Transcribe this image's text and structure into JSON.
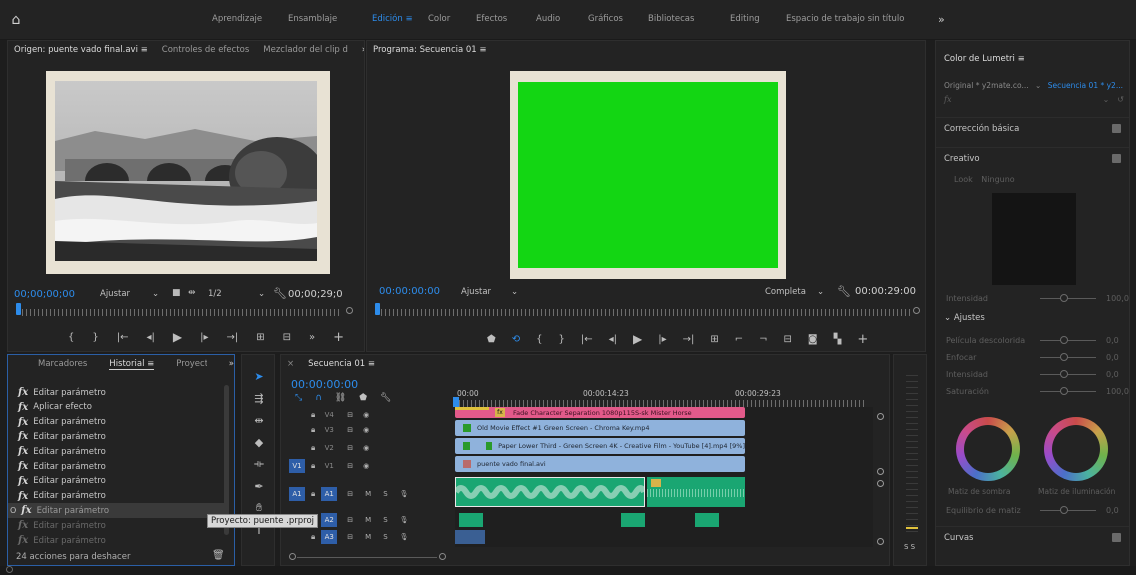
{
  "topbar": {
    "workspaces": [
      "Aprendizaje",
      "Ensamblaje",
      "Edición",
      "Color",
      "Efectos",
      "Audio",
      "Gráficos",
      "Bibliotecas",
      "Editing",
      "Espacio de trabajo sin título"
    ],
    "active": "Edición",
    "active_menu_glyph": "≡",
    "more_glyph": "»"
  },
  "source": {
    "tabs": [
      "Origen: puente vado final.avi",
      "Controles de efectos",
      "Mezclador del clip d"
    ],
    "tab_menu_glyph": "≡",
    "more_glyph": "»",
    "timecode": "00;00;00;00",
    "fit_label": "Ajustar",
    "resolution": "1/2",
    "duration": "00;00;29;0"
  },
  "program": {
    "title": "Programa: Secuencia 01",
    "title_menu_glyph": "≡",
    "timecode": "00:00:00:00",
    "fit_label": "Ajustar",
    "quality": "Completa",
    "duration": "00:00:29:00"
  },
  "project": {
    "tabs": [
      "Marcadores",
      "Historial",
      "Proyecto"
    ],
    "active": "Historial",
    "tab_menu_glyph": "≡",
    "more_glyph": "»",
    "history": [
      {
        "label": "Editar parámetro",
        "state": "normal"
      },
      {
        "label": "Aplicar efecto",
        "state": "normal"
      },
      {
        "label": "Editar parámetro",
        "state": "normal"
      },
      {
        "label": "Editar parámetro",
        "state": "normal"
      },
      {
        "label": "Editar parámetro",
        "state": "normal"
      },
      {
        "label": "Editar parámetro",
        "state": "normal"
      },
      {
        "label": "Editar parámetro",
        "state": "normal"
      },
      {
        "label": "Editar parámetro",
        "state": "normal"
      },
      {
        "label": "Editar parámetro",
        "state": "selected"
      },
      {
        "label": "Editar parámetro",
        "state": "dim"
      },
      {
        "label": "Editar parámetro",
        "state": "dim"
      }
    ],
    "status": "24 acciones para deshacer",
    "tooltip": "Proyecto: puente .prproj"
  },
  "timeline": {
    "title": "Secuencia 01",
    "title_menu_glyph": "≡",
    "timecode": "00:00:00:00",
    "ruler_labels": [
      "00:00",
      "00:00:14:23",
      "00:00:29:23"
    ],
    "tracks": [
      {
        "id": "V4",
        "src": ""
      },
      {
        "id": "V3",
        "src": ""
      },
      {
        "id": "V2",
        "src": ""
      },
      {
        "id": "V1",
        "src": "V1"
      },
      {
        "id": "A1",
        "src": "A1"
      },
      {
        "id": "A2",
        "src": ""
      },
      {
        "id": "A3",
        "src": ""
      }
    ],
    "track_flags": [
      "M",
      "S"
    ],
    "clips": [
      {
        "name": "Fade Character Separation 1080p115S-sk Mister Horse",
        "color": "#e35a8a"
      },
      {
        "name": "Old Movie Effect #1   Green Screen - Chroma Key.mp4",
        "color": "#8fb2dc"
      },
      {
        "name": "Paper Lower Third - Green Screen 4K - Creative Film - YouTube [4].mp4 [9%]",
        "color": "#8fb2dc"
      },
      {
        "name": "puente vado final.avi",
        "color": "#8fb2dc"
      }
    ],
    "meter_label": "S S"
  },
  "lumetri": {
    "title": "Color de Lumetri",
    "title_menu_glyph": "≡",
    "source_label": "Original * y2mate.co...",
    "target_label": "Secuencia 01 * y2...",
    "fx_label": "fx",
    "sections": [
      {
        "label": "Corrección básica"
      },
      {
        "label": "Creativo"
      }
    ],
    "look_label": "Look",
    "look_value": "Ninguno",
    "intensity_label": "Intensidad",
    "intensity_value": "100,0",
    "adjustments_label": "Ajustes",
    "adjustments": [
      {
        "label": "Película descolorida",
        "value": "0,0"
      },
      {
        "label": "Enfocar",
        "value": "0,0"
      },
      {
        "label": "Intensidad",
        "value": "0,0"
      },
      {
        "label": "Saturación",
        "value": "100,0"
      }
    ],
    "wheel_labels": [
      "Matiz de sombra",
      "Matiz de iluminación"
    ],
    "balance_label": "Equilibrio de matiz",
    "balance_value": "0,0",
    "curves_label": "Curvas"
  },
  "colors": {
    "accent": "#2d8ceb",
    "program_monitor": "#13d613",
    "pink_clip": "#e35a8a",
    "video_clip": "#8fb2dc",
    "audio_clip": "#1aa672"
  },
  "icons": [
    "home-icon",
    "menu-icon",
    "wrench-icon",
    "play-icon",
    "step-back-icon",
    "step-forward-icon",
    "camera-icon",
    "selection-tool-icon",
    "razor-tool-icon",
    "hand-tool-icon",
    "pen-tool-icon",
    "trash-icon",
    "mic-icon",
    "lock-icon",
    "eye-icon",
    "magnet-icon"
  ]
}
